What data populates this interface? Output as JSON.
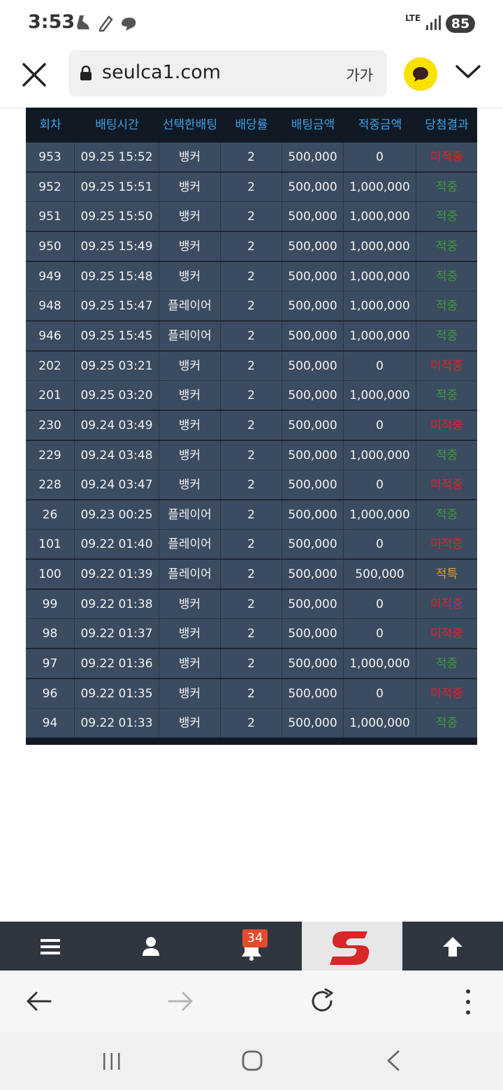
{
  "status_bar": {
    "time": "3:53",
    "network": "LTE",
    "battery": "85"
  },
  "browser": {
    "url": "seulca1.com",
    "text_size_label": "가가"
  },
  "table": {
    "headers": [
      "회차",
      "배팅시간",
      "선택한배팅",
      "배당률",
      "배팅금액",
      "적중금액",
      "당첨결과"
    ],
    "rows": [
      [
        "953",
        "09.25 15:52",
        "뱅커",
        "2",
        "500,000",
        "0",
        "미적중"
      ],
      [
        "952",
        "09.25 15:51",
        "뱅커",
        "2",
        "500,000",
        "1,000,000",
        "적중"
      ],
      [
        "951",
        "09.25 15:50",
        "뱅커",
        "2",
        "500,000",
        "1,000,000",
        "적중"
      ],
      [
        "950",
        "09.25 15:49",
        "뱅커",
        "2",
        "500,000",
        "1,000,000",
        "적중"
      ],
      [
        "949",
        "09.25 15:48",
        "뱅커",
        "2",
        "500,000",
        "1,000,000",
        "적중"
      ],
      [
        "948",
        "09.25 15:47",
        "플레이어",
        "2",
        "500,000",
        "1,000,000",
        "적중"
      ],
      [
        "946",
        "09.25 15:45",
        "플레이어",
        "2",
        "500,000",
        "1,000,000",
        "적중"
      ],
      [
        "202",
        "09.25 03:21",
        "뱅커",
        "2",
        "500,000",
        "0",
        "미적중"
      ],
      [
        "201",
        "09.25 03:20",
        "뱅커",
        "2",
        "500,000",
        "1,000,000",
        "적중"
      ],
      [
        "230",
        "09.24 03:49",
        "뱅커",
        "2",
        "500,000",
        "0",
        "미적중"
      ],
      [
        "229",
        "09.24 03:48",
        "뱅커",
        "2",
        "500,000",
        "1,000,000",
        "적중"
      ],
      [
        "228",
        "09.24 03:47",
        "뱅커",
        "2",
        "500,000",
        "0",
        "미적중"
      ],
      [
        "26",
        "09.23 00:25",
        "플레이어",
        "2",
        "500,000",
        "1,000,000",
        "적중"
      ],
      [
        "101",
        "09.22 01:40",
        "플레이어",
        "2",
        "500,000",
        "0",
        "미적중"
      ],
      [
        "100",
        "09.22 01:39",
        "플레이어",
        "2",
        "500,000",
        "500,000",
        "적특"
      ],
      [
        "99",
        "09.22 01:38",
        "뱅커",
        "2",
        "500,000",
        "0",
        "미적중"
      ],
      [
        "98",
        "09.22 01:37",
        "뱅커",
        "2",
        "500,000",
        "0",
        "미적중"
      ],
      [
        "97",
        "09.22 01:36",
        "뱅커",
        "2",
        "500,000",
        "1,000,000",
        "적중"
      ],
      [
        "96",
        "09.22 01:35",
        "뱅커",
        "2",
        "500,000",
        "0",
        "미적중"
      ],
      [
        "94",
        "09.22 01:33",
        "뱅커",
        "2",
        "500,000",
        "1,000,000",
        "적중"
      ]
    ]
  },
  "site_toolbar": {
    "notification_count": "34"
  },
  "colors": {
    "header_text": "#3da0e8",
    "row_bg": "#3b4c60",
    "loss": "#d8262a",
    "win": "#3e9a3c",
    "special": "#e69c22"
  }
}
